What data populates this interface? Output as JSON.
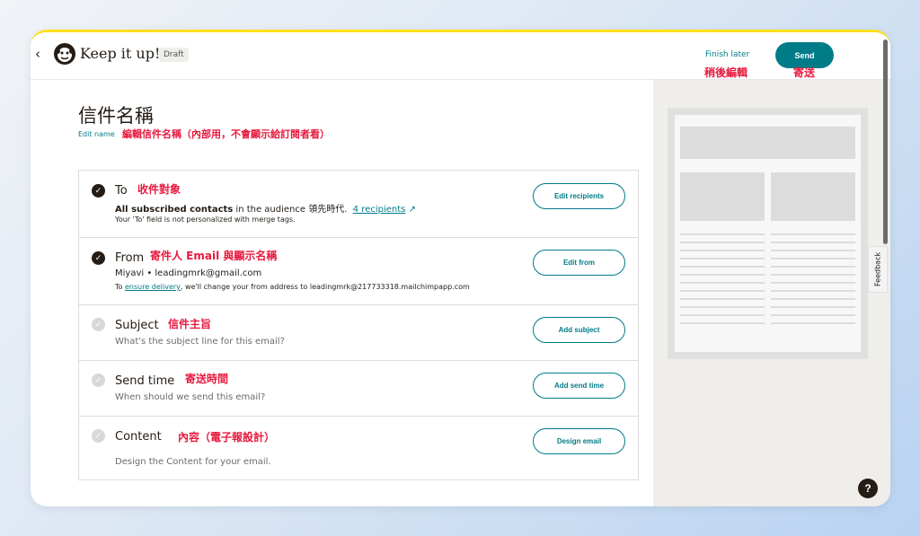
{
  "header": {
    "back_icon": "‹",
    "brand": "Keep it up!",
    "badge": "Draft",
    "finish_later": "Finish later",
    "send": "Send",
    "annotation_finish": "稍後編輯",
    "annotation_send": "寄送"
  },
  "campaign": {
    "title": "信件名稱",
    "edit_name": "Edit name",
    "annotation_edit_name": "編輯信件名稱（內部用，不會顯示給訂閱者看）"
  },
  "steps": [
    {
      "title": "To",
      "annotation": "收件對象",
      "summary_bold": "All subscribed contacts",
      "summary_mid": " in the audience ",
      "summary_audience": "領先時代",
      "summary_link": "4 recipients",
      "note": "Your 'To' field is not personalized with merge tags.",
      "button": "Edit recipients",
      "status": "complete"
    },
    {
      "title": "From",
      "annotation": "寄件人 Email 與顯示名稱",
      "summary": "Miyavi  •  leadingmrk@gmail.com",
      "note_pre": "To ",
      "note_link": "ensure delivery",
      "note_post": ", we'll change your from address to leadingmrk@217733318.mailchimpapp.com",
      "button": "Edit from",
      "status": "complete"
    },
    {
      "title": "Subject",
      "annotation": "信件主旨",
      "hint": "What's the subject line for this email?",
      "button": "Add subject",
      "status": "incomplete"
    },
    {
      "title": "Send time",
      "annotation": "寄送時間",
      "hint": "When should we send this email?",
      "button": "Add send time",
      "status": "incomplete"
    },
    {
      "title": "Content",
      "annotation": "內容（電子報設計）",
      "hint": "Design the Content for your email.",
      "button": "Design email",
      "status": "incomplete"
    }
  ],
  "sidebar": {
    "feedback": "Feedback",
    "help": "?"
  }
}
